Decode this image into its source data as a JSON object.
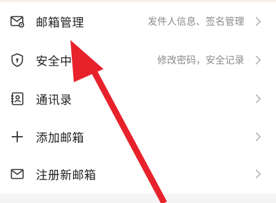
{
  "menu": {
    "items": [
      {
        "label": "邮箱管理",
        "sub": "发件人信息、签名管理",
        "icon": "mail-settings-icon"
      },
      {
        "label": "安全中心",
        "sub": "修改密码，安全记录",
        "icon": "shield-lock-icon"
      },
      {
        "label": "通讯录",
        "sub": "",
        "icon": "contacts-icon"
      },
      {
        "label": "添加邮箱",
        "sub": "",
        "icon": "plus-icon"
      },
      {
        "label": "注册新邮箱",
        "sub": "",
        "icon": "mail-icon"
      }
    ]
  },
  "colors": {
    "text": "#222222",
    "subtext": "#8a8a8a",
    "icon": "#333333",
    "chevron": "#b5b5b5",
    "arrow": "#e8222a"
  }
}
